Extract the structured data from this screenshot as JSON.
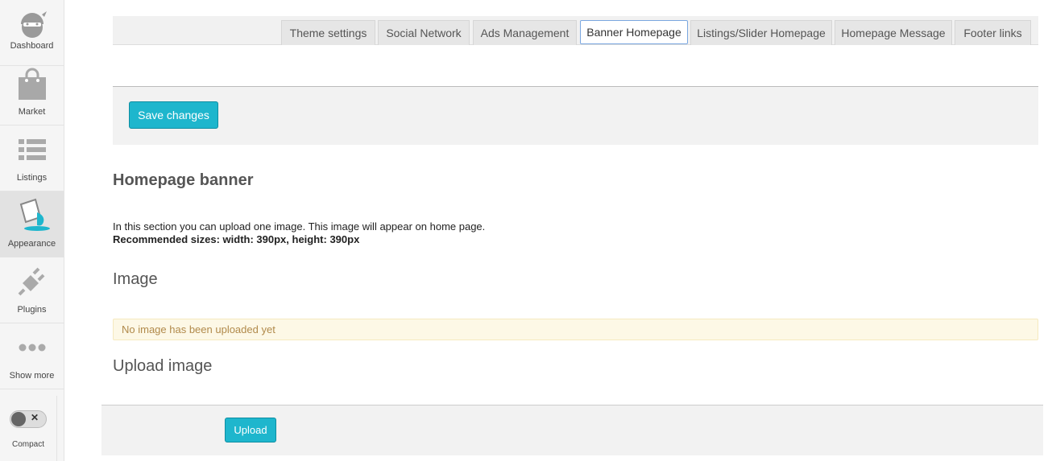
{
  "sidebar": {
    "items": [
      {
        "label": "Dashboard",
        "icon": "dashboard-icon"
      },
      {
        "label": "Market",
        "icon": "market-bag-icon"
      },
      {
        "label": "Listings",
        "icon": "listings-icon"
      },
      {
        "label": "Appearance",
        "icon": "paint-bucket-icon",
        "active": true
      },
      {
        "label": "Plugins",
        "icon": "plug-icon"
      },
      {
        "label": "Show more",
        "icon": "more-dots-icon"
      }
    ],
    "compact_label": "Compact"
  },
  "tabs": [
    {
      "label": "Theme settings"
    },
    {
      "label": "Social Network"
    },
    {
      "label": "Ads Management"
    },
    {
      "label": "Banner Homepage",
      "active": true
    },
    {
      "label": "Listings/Slider Homepage"
    },
    {
      "label": "Homepage Message"
    },
    {
      "label": "Footer links"
    }
  ],
  "save_button": "Save changes",
  "section": {
    "title": "Homepage banner",
    "description": "In this section you can upload one image. This image will appear on home page.",
    "recommended": "Recommended sizes: width: 390px, height: 390px"
  },
  "image": {
    "heading": "Image",
    "empty_message": "No image has been uploaded yet"
  },
  "upload": {
    "heading": "Upload image",
    "button": "Upload"
  },
  "colors": {
    "accent": "#1eb6cd",
    "alert_bg": "#fdf8e6",
    "alert_text": "#b18a4b"
  }
}
